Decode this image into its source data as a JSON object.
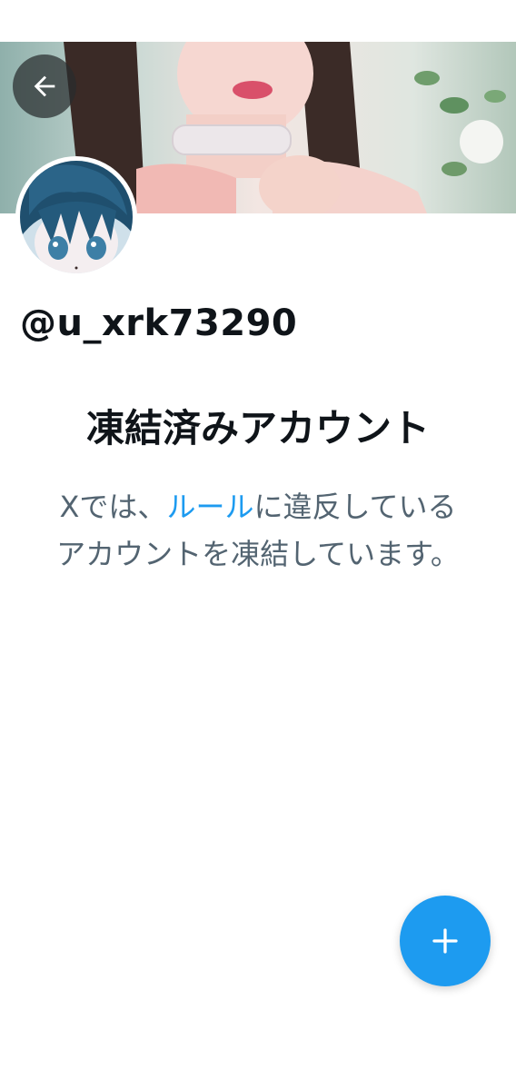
{
  "profile": {
    "handle": "@u_xrk73290"
  },
  "suspended": {
    "title": "凍結済みアカウント",
    "body_prefix": "Xでは、",
    "rules_link": "ルール",
    "body_suffix": "に違反しているアカウントを凍結しています。"
  },
  "icons": {
    "back": "arrow-left-icon",
    "compose": "plus-icon"
  },
  "colors": {
    "accent": "#1d9bf0",
    "text_primary": "#0f1419",
    "text_secondary": "#536471"
  }
}
